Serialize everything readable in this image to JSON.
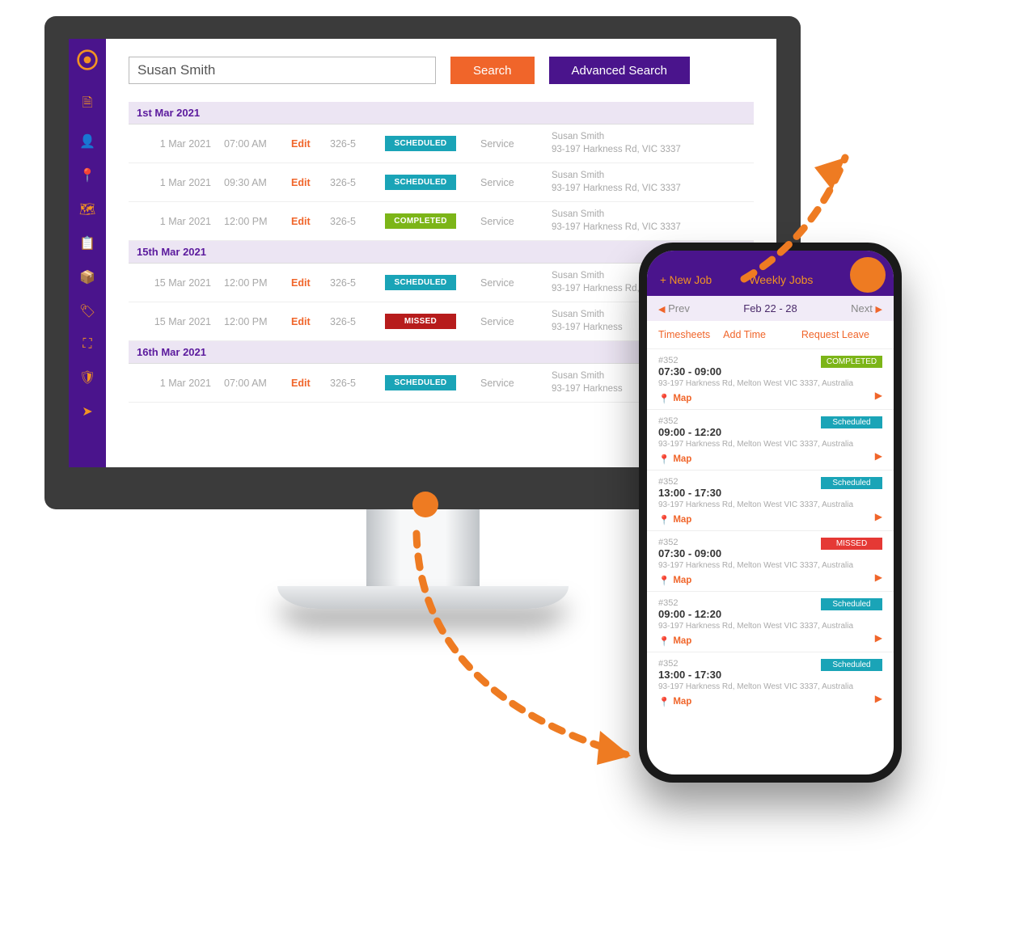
{
  "desktop": {
    "search": {
      "value": "Susan Smith",
      "search_btn": "Search",
      "advanced_btn": "Advanced Search"
    },
    "sidebar_icons": [
      "logo",
      "document-icon",
      "user-icon",
      "pin-icon",
      "map-icon",
      "clipboard-icon",
      "cube-icon",
      "tag-icon",
      "crop-icon",
      "shield-icon",
      "paper-plane-icon"
    ],
    "groups": [
      {
        "label": "1st Mar 2021",
        "rows": [
          {
            "date": "1 Mar 2021",
            "time": "07:00 AM",
            "edit": "Edit",
            "id": "326-5",
            "status": "SCHEDULED",
            "status_class": "st-scheduled",
            "type": "Service",
            "name": "Susan Smith",
            "addr": "93-197 Harkness Rd, VIC 3337"
          },
          {
            "date": "1 Mar 2021",
            "time": "09:30 AM",
            "edit": "Edit",
            "id": "326-5",
            "status": "SCHEDULED",
            "status_class": "st-scheduled",
            "type": "Service",
            "name": "Susan Smith",
            "addr": "93-197 Harkness Rd, VIC 3337"
          },
          {
            "date": "1 Mar 2021",
            "time": "12:00 PM",
            "edit": "Edit",
            "id": "326-5",
            "status": "COMPLETED",
            "status_class": "st-completed",
            "type": "Service",
            "name": "Susan Smith",
            "addr": "93-197 Harkness Rd, VIC 3337"
          }
        ]
      },
      {
        "label": "15th Mar 2021",
        "rows": [
          {
            "date": "15 Mar 2021",
            "time": "12:00 PM",
            "edit": "Edit",
            "id": "326-5",
            "status": "SCHEDULED",
            "status_class": "st-scheduled",
            "type": "Service",
            "name": "Susan Smith",
            "addr": "93-197 Harkness Rd, VIC 3337"
          },
          {
            "date": "15 Mar 2021",
            "time": "12:00 PM",
            "edit": "Edit",
            "id": "326-5",
            "status": "MISSED",
            "status_class": "st-missed",
            "type": "Service",
            "name": "Susan Smith",
            "addr": "93-197 Harkness"
          }
        ]
      },
      {
        "label": "16th Mar 2021",
        "rows": [
          {
            "date": "1 Mar 2021",
            "time": "07:00 AM",
            "edit": "Edit",
            "id": "326-5",
            "status": "SCHEDULED",
            "status_class": "st-scheduled",
            "type": "Service",
            "name": "Susan Smith",
            "addr": "93-197 Harkness"
          }
        ]
      }
    ]
  },
  "mobile": {
    "header": {
      "new_job": "+ New Job",
      "title": "Weekly Jobs"
    },
    "weeknav": {
      "prev": "Prev",
      "range": "Feb 22 - 28",
      "next": "Next"
    },
    "tabs": {
      "timesheets": "Timesheets",
      "add_time": "Add Time",
      "request_leave": "Request Leave"
    },
    "jobs": [
      {
        "id": "#352",
        "time": "07:30 - 09:00",
        "addr": "93-197 Harkness Rd, Melton West VIC 3337, Australia",
        "status": "COMPLETED",
        "status_class": "js-completed",
        "map": "Map"
      },
      {
        "id": "#352",
        "time": "09:00 - 12:20",
        "addr": "93-197 Harkness Rd, Melton West VIC 3337, Australia",
        "status": "Scheduled",
        "status_class": "js-scheduled",
        "map": "Map"
      },
      {
        "id": "#352",
        "time": "13:00 - 17:30",
        "addr": "93-197 Harkness Rd, Melton West VIC 3337, Australia",
        "status": "Scheduled",
        "status_class": "js-scheduled",
        "map": "Map"
      },
      {
        "id": "#352",
        "time": "07:30 - 09:00",
        "addr": "93-197 Harkness Rd, Melton West VIC 3337, Australia",
        "status": "MISSED",
        "status_class": "js-missed",
        "map": "Map"
      },
      {
        "id": "#352",
        "time": "09:00 - 12:20",
        "addr": "93-197 Harkness Rd, Melton West VIC 3337, Australia",
        "status": "Scheduled",
        "status_class": "js-scheduled",
        "map": "Map"
      },
      {
        "id": "#352",
        "time": "13:00 - 17:30",
        "addr": "93-197 Harkness Rd, Melton West VIC 3337, Australia",
        "status": "Scheduled",
        "status_class": "js-scheduled",
        "map": "Map"
      }
    ]
  }
}
